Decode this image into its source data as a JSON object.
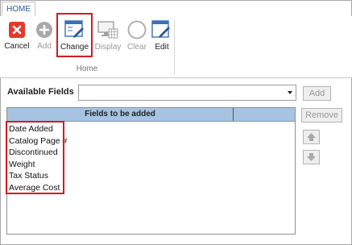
{
  "ribbon": {
    "tab_label": "HOME",
    "group_label": "Home",
    "buttons": {
      "cancel": "Cancel",
      "add": "Add",
      "change": "Change",
      "display": "Display",
      "clear": "Clear",
      "edit": "Edit"
    }
  },
  "form": {
    "available_fields_label": "Available Fields",
    "available_fields_value": "",
    "add_label": "Add",
    "remove_label": "Remove"
  },
  "grid": {
    "header": "Fields to be added",
    "rows": [
      "Date Added",
      "Catalog Page #",
      "Discontinued",
      "Weight",
      "Tax Status",
      "Average Cost"
    ]
  },
  "colors": {
    "cancel_red": "#e03b2c",
    "highlight_red": "#d71920",
    "header_blue": "#a6c3e1",
    "tab_blue": "#2b579a"
  }
}
